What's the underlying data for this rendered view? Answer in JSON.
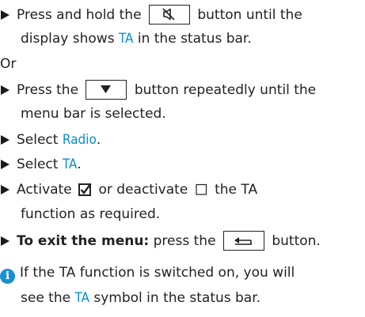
{
  "steps": {
    "s1_pre": "Press and hold the",
    "s1_post": "button until the",
    "s1_line2_pre": "display shows",
    "s1_ta": "TA",
    "s1_line2_post": "in the status bar.",
    "or": "Or",
    "s2_pre": "Press the",
    "s2_post": "button repeatedly until the",
    "s2_line2": "menu bar is selected.",
    "s3_pre": "Select",
    "s3_hl": "Radio",
    "s3_post": ".",
    "s4_pre": "Select",
    "s4_hl": "TA",
    "s4_post": ".",
    "s5_pre": "Activate",
    "s5_mid": "or deactivate",
    "s5_post": "the TA",
    "s5_line2": "function as required.",
    "s6_bold": "To exit the menu:",
    "s6_mid": "press the",
    "s6_post": "button."
  },
  "note": {
    "line1": "If the TA function is switched on, you will",
    "line2_pre": "see the",
    "line2_hl": "TA",
    "line2_post": "symbol in the status bar."
  },
  "icons": {
    "mute": "mute-speaker-icon",
    "down": "down-arrow-icon",
    "back": "back-arrow-icon",
    "checked": "checked-box-icon",
    "unchecked": "empty-box-icon",
    "info": "info-icon",
    "bullet": "triangle-bullet-icon"
  },
  "colors": {
    "highlight": "#0a8fc8",
    "info": "#1791cf",
    "text": "#222222"
  }
}
